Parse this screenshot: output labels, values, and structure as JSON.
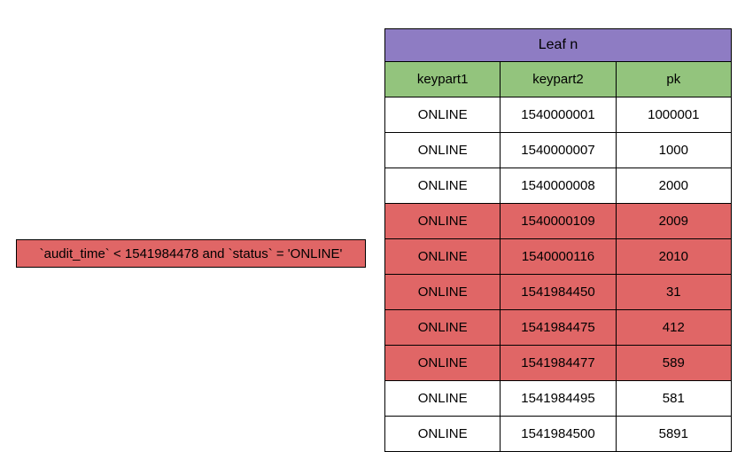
{
  "query": {
    "text": "`audit_time` < 1541984478 and `status` = 'ONLINE'"
  },
  "table": {
    "title": "Leaf n",
    "columns": [
      "keypart1",
      "keypart2",
      "pk"
    ],
    "rows": [
      {
        "keypart1": "ONLINE",
        "keypart2": "1540000001",
        "pk": "1000001",
        "highlight": false
      },
      {
        "keypart1": "ONLINE",
        "keypart2": "1540000007",
        "pk": "1000",
        "highlight": false
      },
      {
        "keypart1": "ONLINE",
        "keypart2": "1540000008",
        "pk": "2000",
        "highlight": false
      },
      {
        "keypart1": "ONLINE",
        "keypart2": "1540000109",
        "pk": "2009",
        "highlight": true
      },
      {
        "keypart1": "ONLINE",
        "keypart2": "1540000116",
        "pk": "2010",
        "highlight": true
      },
      {
        "keypart1": "ONLINE",
        "keypart2": "1541984450",
        "pk": "31",
        "highlight": true
      },
      {
        "keypart1": "ONLINE",
        "keypart2": "1541984475",
        "pk": "412",
        "highlight": true
      },
      {
        "keypart1": "ONLINE",
        "keypart2": "1541984477",
        "pk": "589",
        "highlight": true
      },
      {
        "keypart1": "ONLINE",
        "keypart2": "1541984495",
        "pk": "581",
        "highlight": false
      },
      {
        "keypart1": "ONLINE",
        "keypart2": "1541984500",
        "pk": "5891",
        "highlight": false
      }
    ]
  },
  "colors": {
    "purple": "#8e7cc3",
    "green": "#93c47d",
    "red": "#e06666"
  }
}
